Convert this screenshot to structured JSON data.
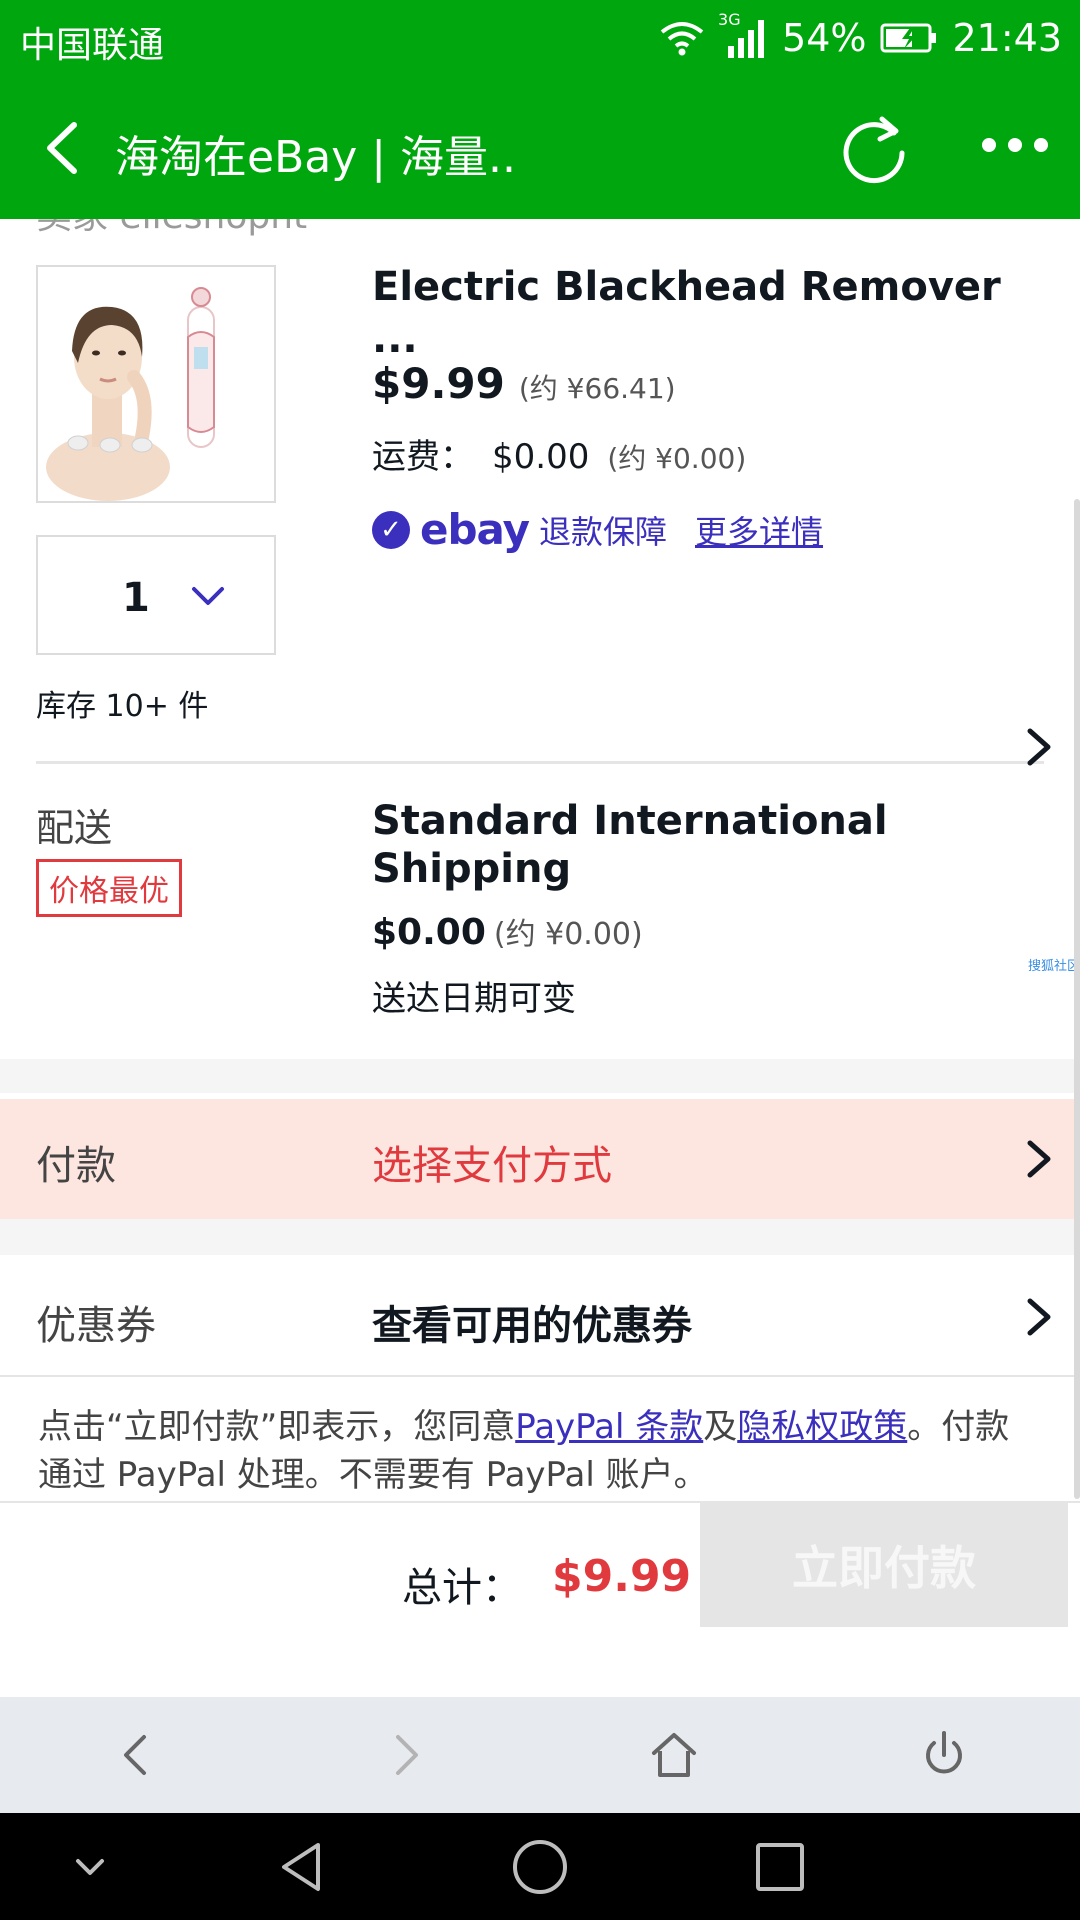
{
  "status_bar": {
    "carrier": "中国联通",
    "network": "3G",
    "battery": "54%",
    "time": "21:43"
  },
  "top_bar": {
    "title": "海淘在eBay | 海量.."
  },
  "seller": {
    "partial_text": "卖家 elleshopnt"
  },
  "item": {
    "title": "Electric Blackhead Remover ...",
    "price": "$9.99",
    "price_approx": "(约 ¥66.41)",
    "shipping_label": "运费：",
    "shipping_price": "$0.00",
    "shipping_approx": "(约 ¥0.00)",
    "guarantee_logo": "ebay",
    "guarantee_text": "退款保障",
    "more_details": "更多详情",
    "quantity": "1",
    "stock": "库存 10+ 件"
  },
  "delivery": {
    "label": "配送",
    "badge": "价格最优",
    "method": "Standard International Shipping",
    "price": "$0.00",
    "price_approx": "(约 ¥0.00)",
    "eta": "送达日期可变",
    "watermark": "搜狐社区"
  },
  "payment": {
    "label": "付款",
    "action": "选择支付方式"
  },
  "coupon": {
    "label": "优惠券",
    "action": "查看可用的优惠券"
  },
  "terms": {
    "part1": "点击“立即付款”即表示，您同意",
    "link1": "PayPal 条款",
    "part2": "及",
    "link2": "隐私权政策",
    "part3": "。付款通过 PayPal 处理。不需要有 PayPal 账户。"
  },
  "footer": {
    "total_label": "总计：",
    "total_value": "$9.99",
    "pay_button": "立即付款"
  },
  "colors": {
    "brand_green": "#00a60e",
    "alert_red": "#e0393e",
    "link_blue": "#3b2fbd",
    "payment_bg": "#fde5e0"
  }
}
